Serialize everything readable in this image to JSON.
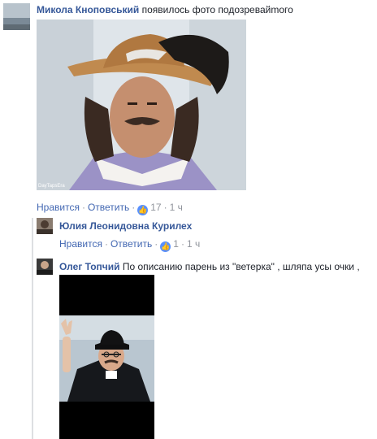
{
  "comments": [
    {
      "author": "Микола Кноповський",
      "text": "появилось фото подозревайmого",
      "actions": {
        "like": "Нравится",
        "reply": "Ответить",
        "likes": "17",
        "time": "1 ч"
      },
      "photo_watermark": "DayTapsEra"
    },
    {
      "author": "Юлия Леонидовна Курилех",
      "text": "",
      "actions": {
        "like": "Нравится",
        "reply": "Ответить",
        "likes": "1",
        "time": "1 ч"
      }
    },
    {
      "author": "Олег Топчий",
      "text": "По описанию парень из \"ветерка\" , шляпа усы очки ,"
    }
  ],
  "icons": {
    "like": "thumbs-up-icon"
  },
  "colors": {
    "name": "#365899",
    "link": "#4267b2",
    "like_badge": "#5890ff",
    "meta": "#90949c"
  }
}
